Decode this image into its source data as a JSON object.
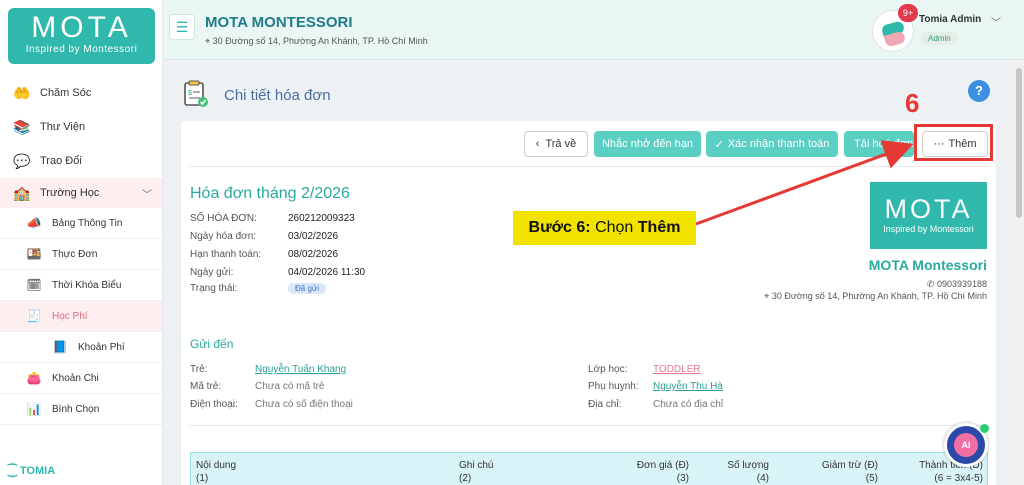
{
  "logo": {
    "main": "MOTA",
    "tagline": "Inspired by Montessori"
  },
  "sidebar": {
    "items": [
      {
        "label": "Chăm Sóc",
        "icon": "care-icon"
      },
      {
        "label": "Thư Viện",
        "icon": "library-icon"
      },
      {
        "label": "Trao Đổi",
        "icon": "chat-icon"
      },
      {
        "label": "Trường Học",
        "icon": "school-icon"
      }
    ],
    "subitems": [
      {
        "label": "Bảng Thông Tin",
        "icon": "megaphone-icon"
      },
      {
        "label": "Thực Đơn",
        "icon": "menu-food-icon"
      },
      {
        "label": "Thời Khóa Biểu",
        "icon": "timetable-icon"
      },
      {
        "label": "Học Phí",
        "icon": "tuition-icon"
      },
      {
        "label": "Khoản Phí",
        "icon": "fee-item-icon"
      },
      {
        "label": "Khoản Chi",
        "icon": "expense-icon"
      },
      {
        "label": "Bình Chọn",
        "icon": "vote-icon"
      }
    ],
    "footer_brand": "TOMIA"
  },
  "header": {
    "school_name": "MOTA MONTESSORI",
    "school_address": "30 Đường số 14, Phường An Khánh, TP. Hồ Chí Minh",
    "notif_count": "9+",
    "user_name": "Tomia Admin",
    "user_role": "Admin"
  },
  "page": {
    "title": "Chi tiết hóa đơn",
    "help": "?"
  },
  "toolbar": {
    "back": "Trả về",
    "remind": "Nhắc nhở đến hạn",
    "confirm": "Xác nhận thanh toán",
    "download": "Tải hoá đơn",
    "more": "Thêm"
  },
  "invoice": {
    "title": "Hóa đơn tháng 2/2026",
    "fields": [
      {
        "label": "SỐ HÓA ĐƠN:",
        "value": "260212009323"
      },
      {
        "label": "Ngày hóa đơn:",
        "value": "03/02/2026"
      },
      {
        "label": "Hạn thanh toán:",
        "value": "08/02/2026"
      },
      {
        "label": "Ngày gửi:",
        "value": "04/02/2026 11:30"
      }
    ],
    "status_label": "Trạng thái:",
    "status_value": "Đã gửi"
  },
  "school_card": {
    "logo_main": "MOTA",
    "logo_tagline": "Inspired by Montessori",
    "name": "MOTA Montessori",
    "phone": "0903939188",
    "address": "30 Đường số 14, Phường An Khánh, TP. Hồ Chí Minh"
  },
  "recipient": {
    "title": "Gửi đến",
    "student_label": "Trẻ:",
    "student_value": "Nguyễn Tuấn Khang",
    "code_label": "Mã trẻ:",
    "code_value": "Chưa có mã trẻ",
    "phone_label": "Điện thoại:",
    "phone_value": "Chưa có số điện thoại",
    "class_label": "Lớp học:",
    "class_value": "TODDLER",
    "parent_label": "Phụ huynh:",
    "parent_value": "Nguyễn Thu Hà",
    "address_label": "Địa chỉ:",
    "address_value": "Chưa có địa chỉ"
  },
  "table": {
    "headers": [
      {
        "label": "Nội dung",
        "num": "(1)"
      },
      {
        "label": "Ghi chú",
        "num": "(2)"
      },
      {
        "label": "Đơn giá (Đ)",
        "num": "(3)"
      },
      {
        "label": "Số lượng",
        "num": "(4)"
      },
      {
        "label": "Giảm trừ (Đ)",
        "num": "(5)"
      },
      {
        "label": "Thành tiền (Đ)",
        "num": "(6 = 3x4-5)"
      }
    ]
  },
  "annotation": {
    "step_number": "6",
    "step_prefix": "Bước 6:",
    "step_action": "Chọn",
    "step_target": "Thêm",
    "color": "#e53935"
  },
  "ai_label": "AI"
}
